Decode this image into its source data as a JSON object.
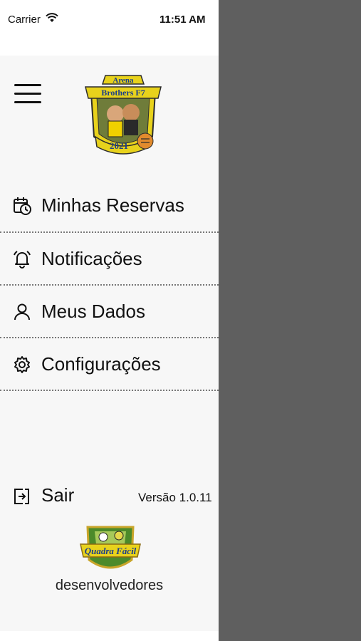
{
  "status_bar": {
    "carrier": "Carrier",
    "time": "11:51 AM"
  },
  "header": {
    "logo_lines": [
      "Arena",
      "Brothers F7",
      "2021"
    ],
    "menu_icon": "hamburger-icon"
  },
  "menu": {
    "items": [
      {
        "label": "Minhas Reservas",
        "icon": "calendar-clock-icon"
      },
      {
        "label": "Notificações",
        "icon": "bell-icon"
      },
      {
        "label": "Meus Dados",
        "icon": "user-icon"
      },
      {
        "label": "Configurações",
        "icon": "gear-icon"
      }
    ]
  },
  "footer": {
    "logout_label": "Sair",
    "logout_icon": "logout-icon",
    "version": "Versão 1.0.11",
    "dev_logo_text": "Quadra Fácil",
    "dev_label": "desenvolvedores"
  },
  "colors": {
    "drawer_bg": "#f7f7f7",
    "overlay": "#5f5f5f",
    "logo_yellow": "#e8d21c",
    "logo_green": "#4c8a2a"
  }
}
